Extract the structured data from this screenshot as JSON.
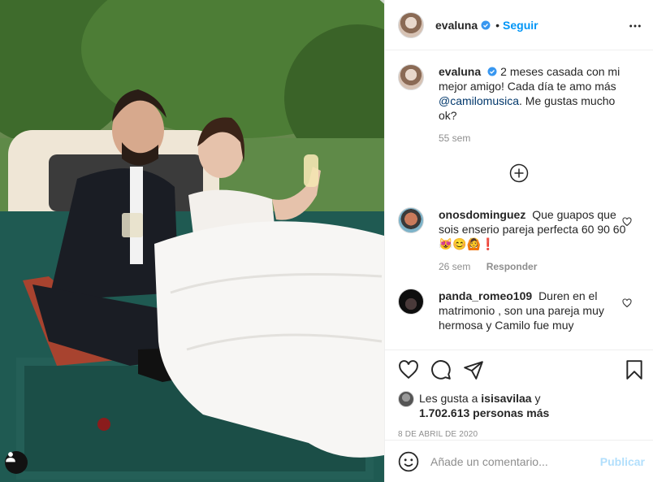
{
  "colors": {
    "accent": "#0095f6",
    "text": "#262626",
    "muted": "#8e8e8e",
    "mention": "#00376b",
    "publish_disabled": "#b2dffc"
  },
  "post": {
    "photo_alt_icon": "user-tag-icon",
    "header": {
      "username": "evaluna",
      "verified": true,
      "follow_label": "Seguir",
      "separator": "•",
      "more_icon": "more-options-icon"
    },
    "caption": {
      "username": "evaluna",
      "text_before": "2 meses casada con mi mejor amigo! Cada día te amo más ",
      "mention": "@camilomusica",
      "text_after": ". Me gustas mucho ok?",
      "time": "55 sem"
    },
    "load_more_icon": "plus-circle-icon",
    "comments": [
      {
        "username": "onosdominguez",
        "text": "Que guapos que sois enserio pareja perfecta 60 90 60😻😊🙆❗",
        "time": "26 sem",
        "reply_label": "Responder"
      },
      {
        "username": "panda_romeo109",
        "text": "Duren en el matrimonio , son una pareja muy hermosa y Camilo fue muy",
        "time": "",
        "reply_label": ""
      }
    ],
    "likes": {
      "prefix": "Les gusta a ",
      "user": "isisavilaa",
      "middle": " y",
      "count": "1.702.613 personas más"
    },
    "date": "8 DE ABRIL DE 2020",
    "add_comment": {
      "placeholder": "Añade un comentario...",
      "publish_label": "Publicar",
      "emoji_icon": "emoji-icon"
    }
  }
}
